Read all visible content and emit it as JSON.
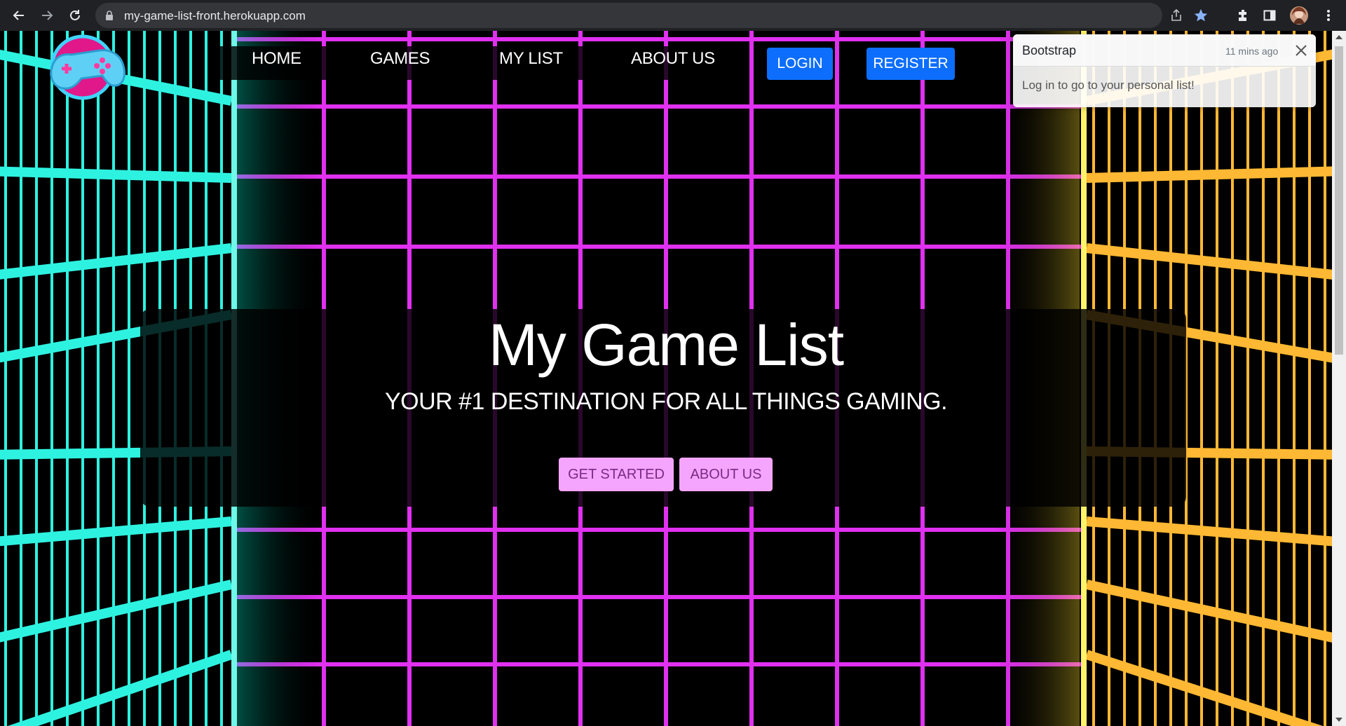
{
  "browser": {
    "url": "my-game-list-front.herokuapp.com",
    "icons": [
      "back-icon",
      "forward-icon",
      "reload-icon",
      "lock-icon",
      "share-icon",
      "star-icon",
      "extensions-icon",
      "side-panel-icon",
      "profile-avatar",
      "menu-icon"
    ],
    "star_color": "#8ab4f8"
  },
  "nav": {
    "home": "HOME",
    "games": "GAMES",
    "my_list": "MY LIST",
    "about_us": "ABOUT US",
    "login": "LOGIN",
    "register": "REGISTER"
  },
  "hero": {
    "title": "My Game List",
    "subtitle": "YOUR #1 DESTINATION FOR ALL THINGS GAMING.",
    "get_started": "GET STARTED",
    "about_us": "ABOUT US"
  },
  "toast": {
    "title": "Bootstrap",
    "time": "11 mins ago",
    "body": "Log in to go to your personal list!"
  },
  "colors": {
    "grid_magenta": "#e030f0",
    "grid_cyan": "#2ef2e0",
    "grid_gold": "#ffb833",
    "button_blue": "#0d6efd",
    "button_pink": "#f6a5ff"
  }
}
